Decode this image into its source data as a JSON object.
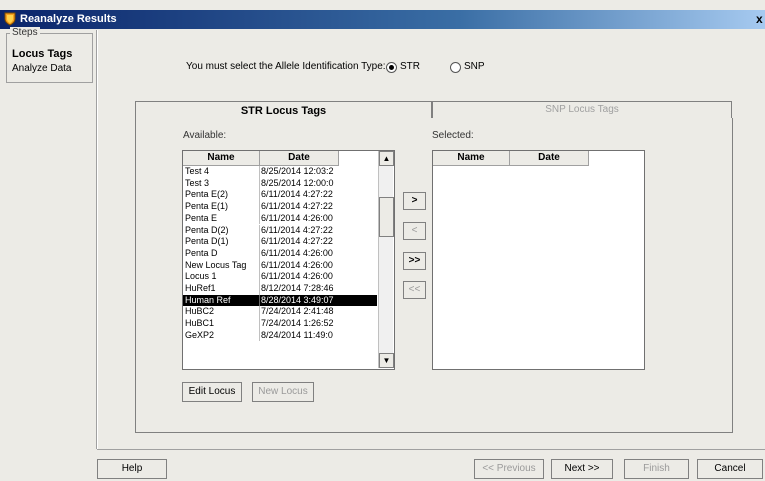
{
  "window": {
    "title": "Reanalyze Results",
    "close_label": "x"
  },
  "steps": {
    "legend": "Steps",
    "items": [
      {
        "label": "Locus Tags"
      },
      {
        "label": "Analyze Data"
      }
    ]
  },
  "allele_type": {
    "prompt": "You must select the Allele Identification Type:",
    "options": [
      {
        "label": "STR",
        "selected": true
      },
      {
        "label": "SNP",
        "selected": false
      }
    ]
  },
  "tabs": [
    {
      "label": "STR Locus Tags",
      "active": true
    },
    {
      "label": "SNP Locus Tags",
      "active": false
    }
  ],
  "available": {
    "label": "Available:",
    "columns": [
      "Name",
      "Date"
    ],
    "rows": [
      {
        "name": "Test 4",
        "date": "8/25/2014 12:03:2"
      },
      {
        "name": "Test 3",
        "date": "8/25/2014 12:00:0"
      },
      {
        "name": "Penta E(2)",
        "date": "6/11/2014 4:27:22"
      },
      {
        "name": "Penta E(1)",
        "date": "6/11/2014 4:27:22"
      },
      {
        "name": "Penta E",
        "date": "6/11/2014 4:26:00"
      },
      {
        "name": "Penta D(2)",
        "date": "6/11/2014 4:27:22"
      },
      {
        "name": "Penta D(1)",
        "date": "6/11/2014 4:27:22"
      },
      {
        "name": "Penta D",
        "date": "6/11/2014 4:26:00"
      },
      {
        "name": "New Locus Tag",
        "date": "6/11/2014 4:26:00"
      },
      {
        "name": "Locus 1",
        "date": "6/11/2014 4:26:00"
      },
      {
        "name": "HuRef1",
        "date": "8/12/2014 7:28:46"
      },
      {
        "name": "Human Ref",
        "date": "8/28/2014 3:49:07",
        "selected": true
      },
      {
        "name": "HuBC2",
        "date": "7/24/2014 2:41:48"
      },
      {
        "name": "HuBC1",
        "date": "7/24/2014 1:26:52"
      },
      {
        "name": "GeXP2",
        "date": "8/24/2014 11:49:0"
      }
    ]
  },
  "selected": {
    "label": "Selected:",
    "columns": [
      "Name",
      "Date"
    ],
    "rows": []
  },
  "move_buttons": [
    {
      "label": ">",
      "enabled": true
    },
    {
      "label": "<",
      "enabled": false
    },
    {
      "label": ">>",
      "enabled": true
    },
    {
      "label": "<<",
      "enabled": false
    }
  ],
  "locus_buttons": {
    "edit": "Edit Locus",
    "new": "New Locus"
  },
  "footer": {
    "help": "Help",
    "previous": "<< Previous",
    "next": "Next >>",
    "finish": "Finish",
    "cancel": "Cancel"
  }
}
